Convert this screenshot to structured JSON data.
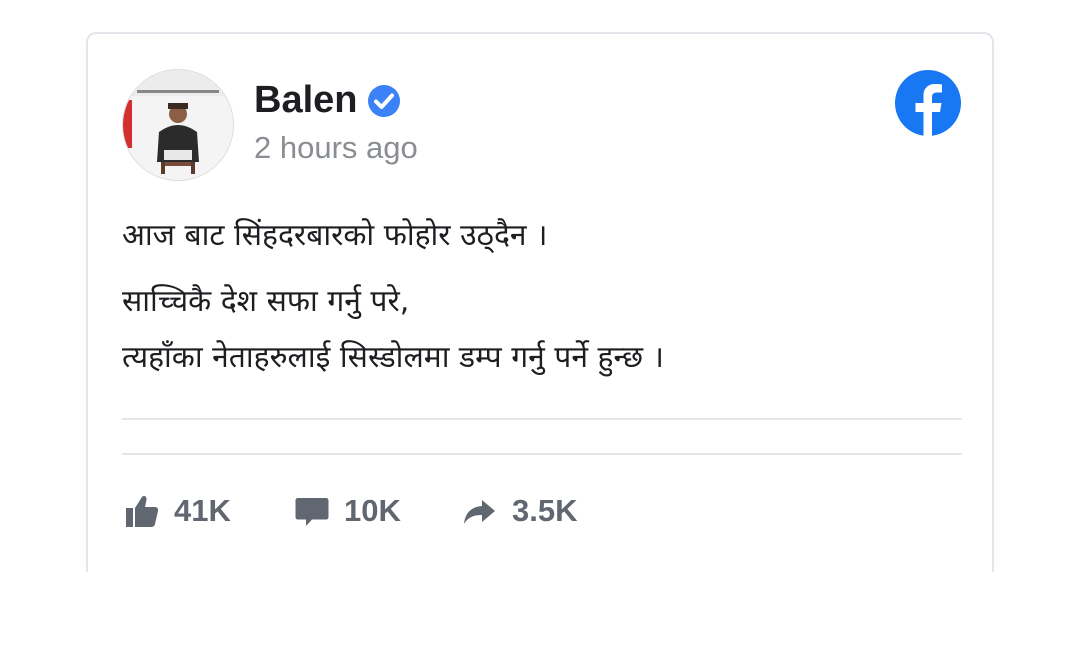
{
  "post": {
    "author": "Balen",
    "verified_icon": "verified-badge-icon",
    "timestamp": "2 hours ago",
    "platform_icon": "facebook-logo-icon",
    "text_lines": [
      "आज बाट सिंहदरबारको फोहोर उठ्दैन ।",
      "साच्चिकै देश सफा गर्नु परे,",
      "त्यहाँका नेताहरुलाई सिस्डोलमा डम्प गर्नु पर्ने हुन्छ ।"
    ]
  },
  "stats": {
    "likes": "41K",
    "comments": "10K",
    "shares": "3.5K",
    "like_icon": "thumbs-up-icon",
    "comment_icon": "comment-bubble-icon",
    "share_icon": "share-arrow-icon"
  },
  "colors": {
    "facebook_blue": "#1877f2",
    "verified_blue": "#3b82f6",
    "name": "#1c1e21",
    "muted": "#8a8d91",
    "stat_gray": "#606770",
    "divider": "#e4e6eb"
  }
}
